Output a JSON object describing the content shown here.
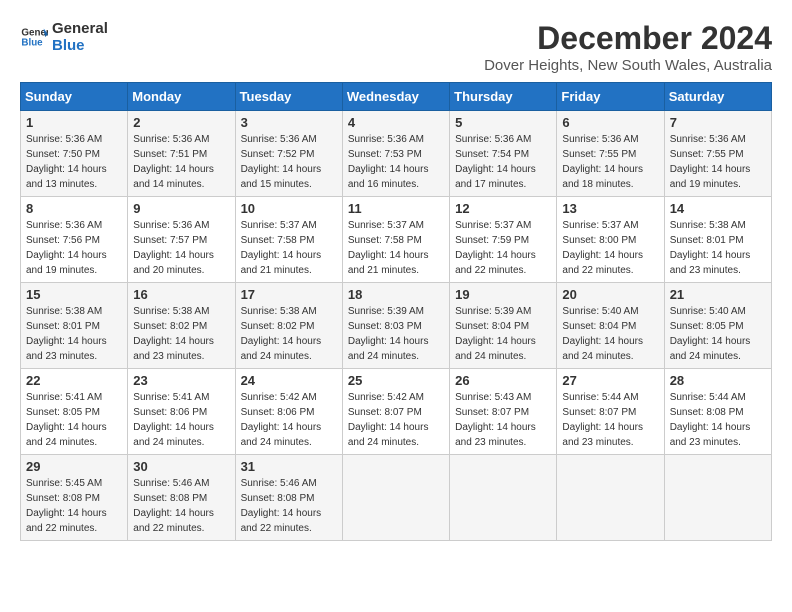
{
  "logo": {
    "line1": "General",
    "line2": "Blue"
  },
  "title": "December 2024",
  "subtitle": "Dover Heights, New South Wales, Australia",
  "days_header": [
    "Sunday",
    "Monday",
    "Tuesday",
    "Wednesday",
    "Thursday",
    "Friday",
    "Saturday"
  ],
  "weeks": [
    [
      {
        "day": "1",
        "sunrise": "5:36 AM",
        "sunset": "7:50 PM",
        "daylight": "14 hours and 13 minutes."
      },
      {
        "day": "2",
        "sunrise": "5:36 AM",
        "sunset": "7:51 PM",
        "daylight": "14 hours and 14 minutes."
      },
      {
        "day": "3",
        "sunrise": "5:36 AM",
        "sunset": "7:52 PM",
        "daylight": "14 hours and 15 minutes."
      },
      {
        "day": "4",
        "sunrise": "5:36 AM",
        "sunset": "7:53 PM",
        "daylight": "14 hours and 16 minutes."
      },
      {
        "day": "5",
        "sunrise": "5:36 AM",
        "sunset": "7:54 PM",
        "daylight": "14 hours and 17 minutes."
      },
      {
        "day": "6",
        "sunrise": "5:36 AM",
        "sunset": "7:55 PM",
        "daylight": "14 hours and 18 minutes."
      },
      {
        "day": "7",
        "sunrise": "5:36 AM",
        "sunset": "7:55 PM",
        "daylight": "14 hours and 19 minutes."
      }
    ],
    [
      {
        "day": "8",
        "sunrise": "5:36 AM",
        "sunset": "7:56 PM",
        "daylight": "14 hours and 19 minutes."
      },
      {
        "day": "9",
        "sunrise": "5:36 AM",
        "sunset": "7:57 PM",
        "daylight": "14 hours and 20 minutes."
      },
      {
        "day": "10",
        "sunrise": "5:37 AM",
        "sunset": "7:58 PM",
        "daylight": "14 hours and 21 minutes."
      },
      {
        "day": "11",
        "sunrise": "5:37 AM",
        "sunset": "7:58 PM",
        "daylight": "14 hours and 21 minutes."
      },
      {
        "day": "12",
        "sunrise": "5:37 AM",
        "sunset": "7:59 PM",
        "daylight": "14 hours and 22 minutes."
      },
      {
        "day": "13",
        "sunrise": "5:37 AM",
        "sunset": "8:00 PM",
        "daylight": "14 hours and 22 minutes."
      },
      {
        "day": "14",
        "sunrise": "5:38 AM",
        "sunset": "8:01 PM",
        "daylight": "14 hours and 23 minutes."
      }
    ],
    [
      {
        "day": "15",
        "sunrise": "5:38 AM",
        "sunset": "8:01 PM",
        "daylight": "14 hours and 23 minutes."
      },
      {
        "day": "16",
        "sunrise": "5:38 AM",
        "sunset": "8:02 PM",
        "daylight": "14 hours and 23 minutes."
      },
      {
        "day": "17",
        "sunrise": "5:38 AM",
        "sunset": "8:02 PM",
        "daylight": "14 hours and 24 minutes."
      },
      {
        "day": "18",
        "sunrise": "5:39 AM",
        "sunset": "8:03 PM",
        "daylight": "14 hours and 24 minutes."
      },
      {
        "day": "19",
        "sunrise": "5:39 AM",
        "sunset": "8:04 PM",
        "daylight": "14 hours and 24 minutes."
      },
      {
        "day": "20",
        "sunrise": "5:40 AM",
        "sunset": "8:04 PM",
        "daylight": "14 hours and 24 minutes."
      },
      {
        "day": "21",
        "sunrise": "5:40 AM",
        "sunset": "8:05 PM",
        "daylight": "14 hours and 24 minutes."
      }
    ],
    [
      {
        "day": "22",
        "sunrise": "5:41 AM",
        "sunset": "8:05 PM",
        "daylight": "14 hours and 24 minutes."
      },
      {
        "day": "23",
        "sunrise": "5:41 AM",
        "sunset": "8:06 PM",
        "daylight": "14 hours and 24 minutes."
      },
      {
        "day": "24",
        "sunrise": "5:42 AM",
        "sunset": "8:06 PM",
        "daylight": "14 hours and 24 minutes."
      },
      {
        "day": "25",
        "sunrise": "5:42 AM",
        "sunset": "8:07 PM",
        "daylight": "14 hours and 24 minutes."
      },
      {
        "day": "26",
        "sunrise": "5:43 AM",
        "sunset": "8:07 PM",
        "daylight": "14 hours and 23 minutes."
      },
      {
        "day": "27",
        "sunrise": "5:44 AM",
        "sunset": "8:07 PM",
        "daylight": "14 hours and 23 minutes."
      },
      {
        "day": "28",
        "sunrise": "5:44 AM",
        "sunset": "8:08 PM",
        "daylight": "14 hours and 23 minutes."
      }
    ],
    [
      {
        "day": "29",
        "sunrise": "5:45 AM",
        "sunset": "8:08 PM",
        "daylight": "14 hours and 22 minutes."
      },
      {
        "day": "30",
        "sunrise": "5:46 AM",
        "sunset": "8:08 PM",
        "daylight": "14 hours and 22 minutes."
      },
      {
        "day": "31",
        "sunrise": "5:46 AM",
        "sunset": "8:08 PM",
        "daylight": "14 hours and 22 minutes."
      },
      null,
      null,
      null,
      null
    ]
  ]
}
